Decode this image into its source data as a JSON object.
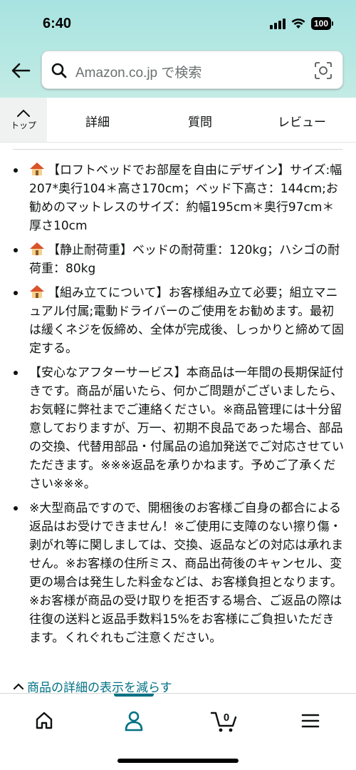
{
  "status_bar": {
    "time": "6:40",
    "battery": "100"
  },
  "search": {
    "placeholder": "Amazon.co.jp で検索"
  },
  "tabs": {
    "top_label": "トップ",
    "details": "詳細",
    "questions": "質問",
    "reviews": "レビュー"
  },
  "bullets": [
    {
      "icon": "house-icon",
      "text": "【ロフトベッドでお部屋を自由にデザイン】サイズ:幅207*奥行104＊高さ170cm；ベッド下高さ：144cm;お勧めのマットレスのサイズ：約幅195cm＊奥行97cm＊厚さ10cm"
    },
    {
      "icon": "house-icon",
      "text": "【静止耐荷重】ベッドの耐荷重：120kg；ハシゴの耐荷重：80kg"
    },
    {
      "icon": "house-icon",
      "text": "【組み立てについて】お客様組み立て必要；組立マニュアル付属;電動ドライバーのご使用をお勧めます。最初は緩くネジを仮締め、全体が完成後、しっかりと締めて固定する。"
    },
    {
      "icon": "",
      "text": "【安心なアフターサービス】本商品は一年間の長期保証付きです。商品が届いたら、何かご問題がございましたら、お気軽に弊社までご連絡ください。※商品管理には十分留意しておりますが、万一、初期不良品であった場合、部品の交換、代替用部品・付属品の追加発送でご対応させていただきます。※※※返品を承りかねます。予めご了承ください※※※。"
    },
    {
      "icon": "",
      "text": "※大型商品ですので、開梱後のお客様ご自身の都合による返品はお受けできません！※ご使用に支障のない擦り傷・剥がれ等に関しましては、交換、返品などの対応は承れません。※お客様の住所ミス、商品出荷後のキャンセル、変更の場合は発生した料金などは、お客様負担となります。※お客様が商品の受け取りを拒否する場合、ご返品の際は往復の送料と返品手数料15%をお客様にご負担いただきます。くれぐれもご注意ください。"
    }
  ],
  "collapse_link": "商品の詳細の表示を減らす",
  "bottom_nav": {
    "cart_count": "0",
    "active": "account"
  },
  "colors": {
    "header_bg": "#b7e8e3",
    "link": "#007185",
    "text": "#0f1111"
  }
}
